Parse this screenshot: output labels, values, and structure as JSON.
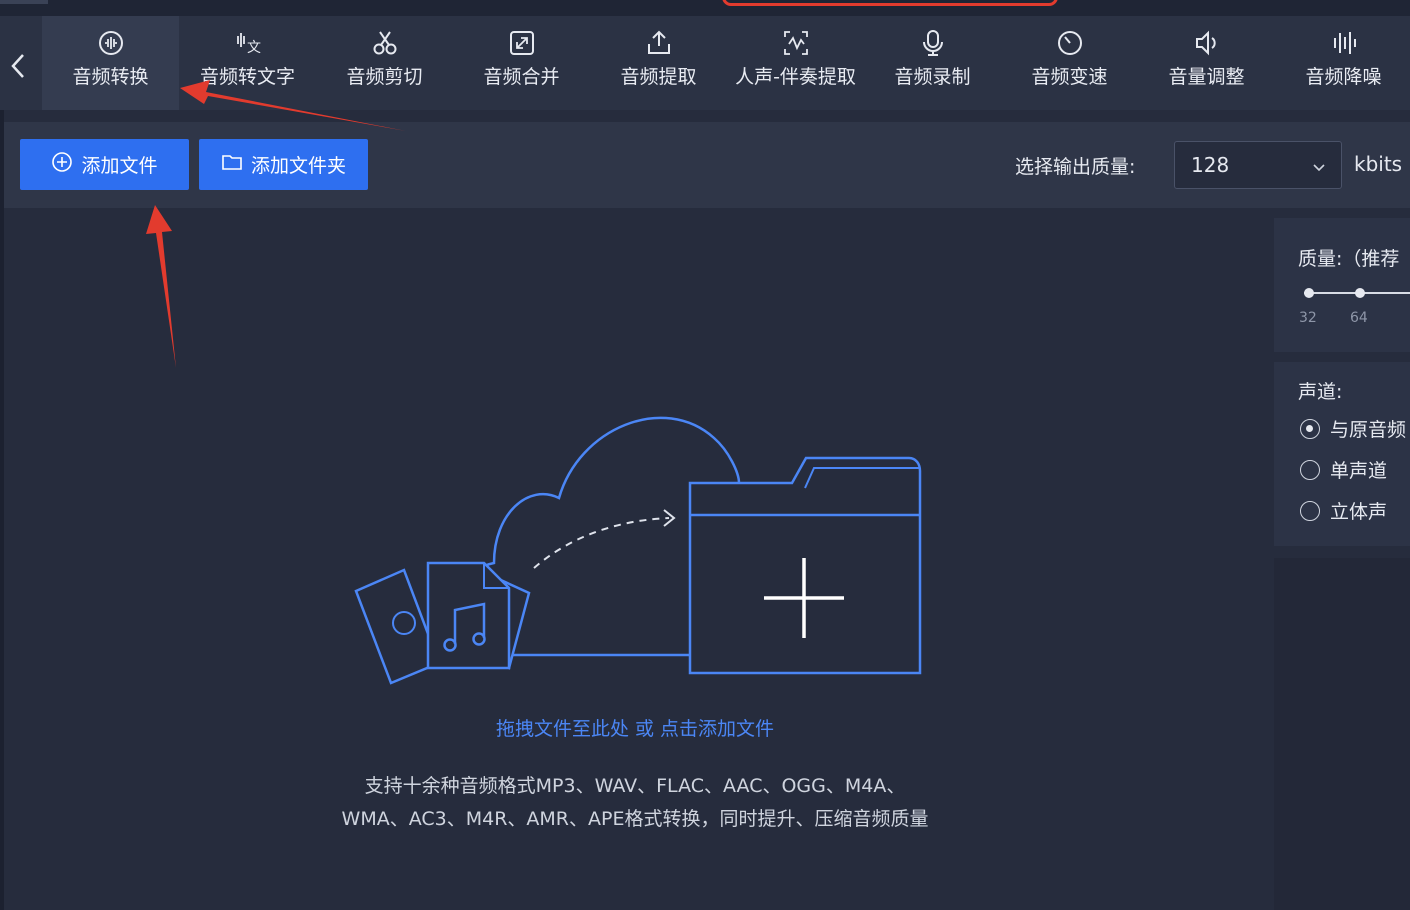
{
  "tabs": [
    {
      "label": "音频转换",
      "icon": "audio-convert-icon"
    },
    {
      "label": "音频转文字",
      "icon": "speech-to-text-icon"
    },
    {
      "label": "音频剪切",
      "icon": "scissors-icon"
    },
    {
      "label": "音频合并",
      "icon": "merge-icon"
    },
    {
      "label": "音频提取",
      "icon": "extract-icon"
    },
    {
      "label": "人声-伴奏提取",
      "icon": "vocal-separate-icon"
    },
    {
      "label": "音频录制",
      "icon": "microphone-icon"
    },
    {
      "label": "音频变速",
      "icon": "speed-icon"
    },
    {
      "label": "音量调整",
      "icon": "volume-icon"
    },
    {
      "label": "音频降噪",
      "icon": "noise-reduce-icon"
    }
  ],
  "toolbar": {
    "add_file_label": "添加文件",
    "add_folder_label": "添加文件夹",
    "quality_label": "选择输出质量:",
    "quality_value": "128",
    "quality_unit": "kbits"
  },
  "dropzone": {
    "hint": "拖拽文件至此处 或 点击添加文件",
    "formats_line1": "支持十余种音频格式MP3、WAV、FLAC、AAC、OGG、M4A、",
    "formats_line2": "WMA、AC3、M4R、AMR、APE格式转换，同时提升、压缩音频质量"
  },
  "side_panel": {
    "quality_title": "质量:（推荐",
    "ticks": [
      "32",
      "64"
    ],
    "channel_title": "声道:",
    "channel_options": [
      {
        "label": "与原音频",
        "selected": true
      },
      {
        "label": "单声道",
        "selected": false
      },
      {
        "label": "立体声",
        "selected": false
      }
    ]
  },
  "colors": {
    "accent": "#2e6ff0",
    "annotation_arrow": "#e23b2e",
    "background": "#262c3d"
  }
}
